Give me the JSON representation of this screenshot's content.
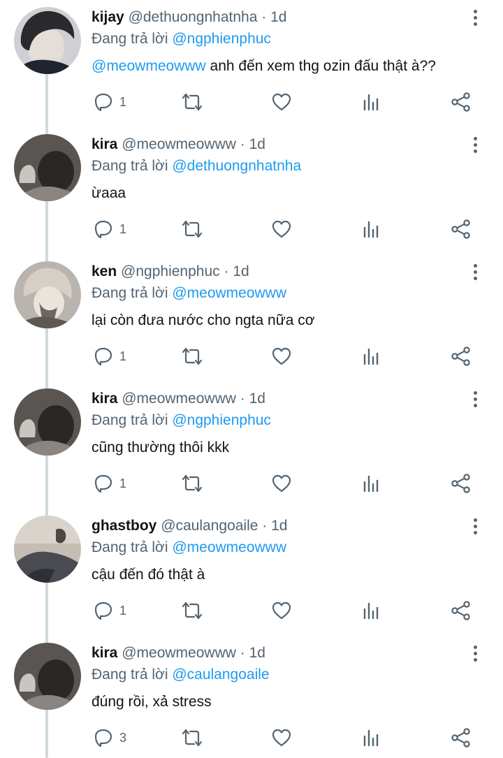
{
  "icons": {
    "reply": "reply-icon",
    "retweet": "retweet-icon",
    "like": "heart-icon",
    "views": "analytics-icon",
    "share": "share-icon",
    "more": "more-vertical-icon"
  },
  "colors": {
    "accent": "#1d9bf0",
    "secondary": "#536471",
    "text": "#0f1419",
    "thread_line": "#cfd9de"
  },
  "tweets": [
    {
      "name": "kijay",
      "handle": "@dethuongnhatnha",
      "dot": "·",
      "time": "1d",
      "reply_prefix": "Đang trả lời",
      "reply_to": "@ngphienphuc",
      "mention": "@meowmeowww",
      "text": " anh đến xem thg ozin đấu thật à??",
      "reply_count": "1"
    },
    {
      "name": "kira",
      "handle": "@meowmeowww",
      "dot": "·",
      "time": "1d",
      "reply_prefix": "Đang trả lời",
      "reply_to": "@dethuongnhatnha",
      "mention": "",
      "text": "ừaaa",
      "reply_count": "1"
    },
    {
      "name": "ken",
      "handle": "@ngphienphuc",
      "dot": "·",
      "time": "1d",
      "reply_prefix": "Đang trả lời",
      "reply_to": "@meowmeowww",
      "mention": "",
      "text": "lại còn đưa nước cho ngta nữa cơ",
      "reply_count": "1"
    },
    {
      "name": "kira",
      "handle": "@meowmeowww",
      "dot": "·",
      "time": "1d",
      "reply_prefix": "Đang trả lời",
      "reply_to": "@ngphienphuc",
      "mention": "",
      "text": "cũng thường thôi kkk",
      "reply_count": "1"
    },
    {
      "name": "ghastboy",
      "handle": "@caulangoaile",
      "dot": "·",
      "time": "1d",
      "reply_prefix": "Đang trả lời",
      "reply_to": "@meowmeowww",
      "mention": "",
      "text": "cậu đến đó thật à",
      "reply_count": "1"
    },
    {
      "name": "kira",
      "handle": "@meowmeowww",
      "dot": "·",
      "time": "1d",
      "reply_prefix": "Đang trả lời",
      "reply_to": "@caulangoaile",
      "mention": "",
      "text": "đúng rồi, xả stress",
      "reply_count": "3"
    }
  ]
}
